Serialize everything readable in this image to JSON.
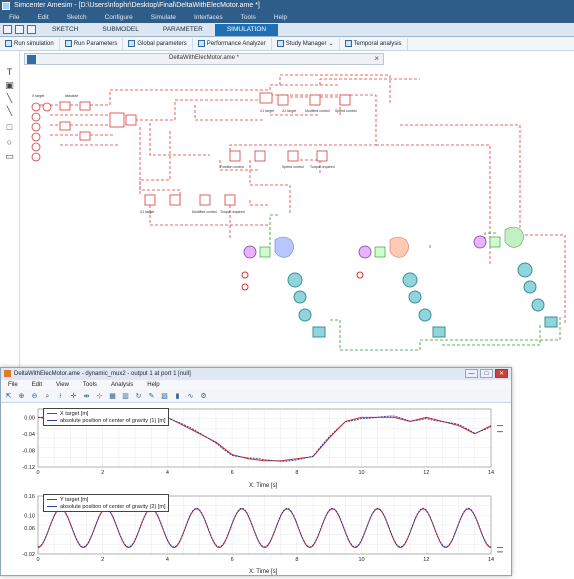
{
  "app": {
    "title": "Simcenter Amesim - [D:\\Users\\nfophr\\Desktop\\Final\\DeltaWithElecMotor.ame *]",
    "menu": [
      "File",
      "Edit",
      "Sketch",
      "Configure",
      "Simulate",
      "Interfaces",
      "Tools",
      "Help"
    ],
    "modes": [
      "SKETCH",
      "SUBMODEL",
      "PARAMETER",
      "SIMULATION"
    ],
    "active_mode": "SIMULATION"
  },
  "toolbar": {
    "items": [
      "Run simulation",
      "Run Parameters",
      "Global parameters",
      "Performance Analyzer",
      "Study Manager",
      "Temporal analysis"
    ]
  },
  "sketch": {
    "title": "DeltaWithElecMotor.ame *",
    "close": "×",
    "labels": {
      "a": "X target",
      "b": "absolute",
      "c": "X1 target",
      "d": "X2 target",
      "e": "Modified control",
      "f": "Speed control",
      "g": "Torque required",
      "h": "Position control"
    }
  },
  "plotwin": {
    "title": "DeltaWithElecMotor.ame - dynamic_mux2 - output 1 at port 1 [null]",
    "menu": [
      "File",
      "Edit",
      "View",
      "Tools",
      "Analysis",
      "Help"
    ],
    "buttons": {
      "min": "—",
      "max": "□",
      "close": "✕"
    }
  },
  "chart_data": [
    {
      "type": "line",
      "series": [
        {
          "name": "X target [m]",
          "color": "#d81b1b"
        },
        {
          "name": "absolute position of center of gravity (1) [m]",
          "color": "#2b3f9e"
        }
      ],
      "x": [
        0,
        0.5,
        1,
        1.5,
        2,
        2.5,
        3,
        3.5,
        4,
        4.5,
        5,
        5.5,
        6,
        6.5,
        7,
        7.5,
        8,
        8.5,
        9,
        9.5,
        10,
        10.5,
        11,
        11.5,
        12,
        12.5,
        13,
        13.5,
        14
      ],
      "values": [
        0,
        -0.005,
        0,
        -0.005,
        0,
        -0.01,
        -0.01,
        0.01,
        0,
        -0.02,
        -0.04,
        -0.06,
        -0.09,
        -0.1,
        -0.105,
        -0.105,
        -0.1,
        -0.095,
        -0.05,
        -0.01,
        0,
        0,
        0,
        -0.01,
        0,
        -0.01,
        -0.02,
        -0.04,
        -0.02
      ],
      "xlabel": "X: Time [s]",
      "xticks": [
        "0",
        "2",
        "4",
        "6",
        "8",
        "10",
        "12",
        "14"
      ],
      "yticks": [
        "0.00",
        "-0.04",
        "-0.08",
        "-0.12"
      ],
      "xlim": [
        0,
        14
      ],
      "ylim": [
        -0.12,
        0.02
      ],
      "grid": true,
      "legend": "top-left"
    },
    {
      "type": "line",
      "series": [
        {
          "name": "Y target [m]",
          "color": "#d81b1b"
        },
        {
          "name": "absolute position of center of gravity (2) [m]",
          "color": "#2b3f9e"
        }
      ],
      "x": [
        0,
        14
      ],
      "amplitude": 0.09,
      "offset": 0.06,
      "cycles": 10,
      "xlabel": "X: Time [s]",
      "xticks": [
        "0",
        "2",
        "4",
        "6",
        "8",
        "10",
        "12",
        "14"
      ],
      "yticks": [
        "0.16",
        "0.10",
        "0.06",
        "-0.02"
      ],
      "xlim": [
        0,
        14
      ],
      "ylim": [
        -0.02,
        0.16
      ],
      "grid": true,
      "legend": "top-left"
    }
  ]
}
